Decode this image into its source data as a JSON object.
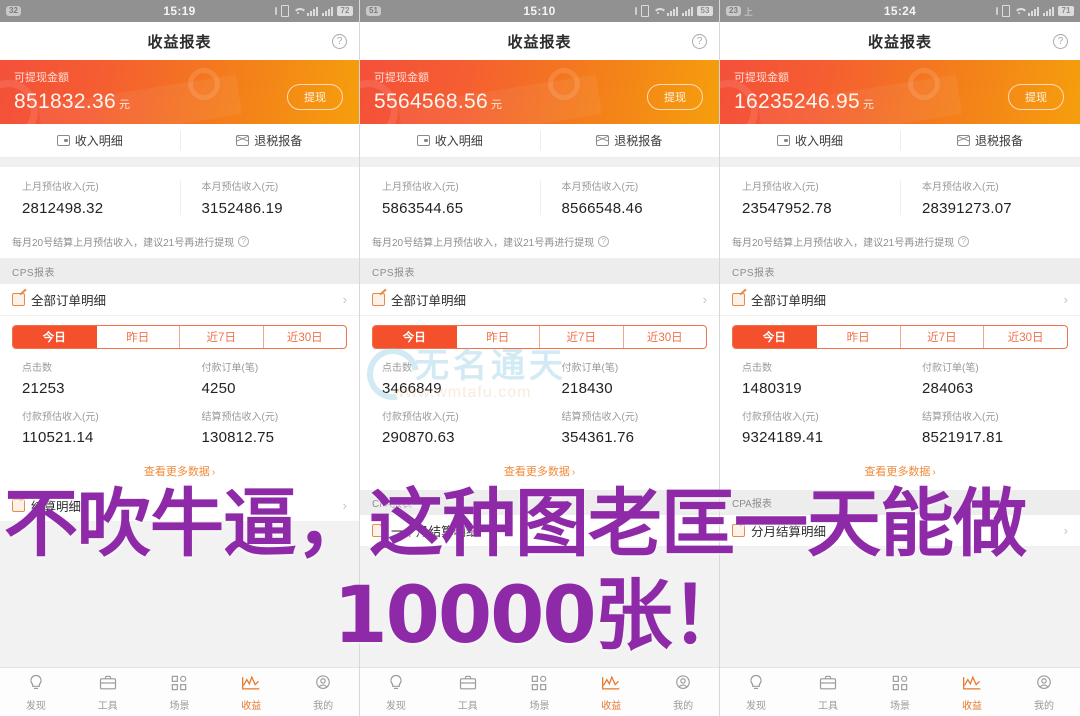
{
  "overlay": {
    "line1": "不吹牛逼，这种图老匡一天能做",
    "line2": "10000张！",
    "color": "#8e2aa8"
  },
  "watermark": {
    "text": "无名通天",
    "url": "www.wmtafu.com"
  },
  "theme": {
    "banner_gradient_start": "#f4503a",
    "banner_gradient_end": "#f59f0c",
    "accent": "#f4502c",
    "tab_active": "#e8762b"
  },
  "common": {
    "nav_title": "收益报表",
    "help_icon": "question-circle-icon",
    "banner_label": "可提现金额",
    "banner_unit": "元",
    "withdraw_label": "提现",
    "entry_income": "收入明细",
    "entry_tax": "退税报备",
    "est_last_label": "上月预估收入(元)",
    "est_this_label": "本月预估收入(元)",
    "notice": "每月20号结算上月预估收入，建议21号再进行提现",
    "cps_section": "CPS报表",
    "all_orders": "全部订单明细",
    "segments": [
      "今日",
      "昨日",
      "近7日",
      "近30日"
    ],
    "active_segment": "今日",
    "stat_clicks_label": "点击数",
    "stat_paid_orders_label": "付款订单(笔)",
    "stat_paid_income_label": "付款预估收入(元)",
    "stat_settle_income_label": "结算预估收入(元)",
    "more_label": "查看更多数据",
    "settle_detail": "结算明细",
    "month_detail": "一个月结算明细",
    "cpa_section": "CPA报表",
    "cpa_detail": "分月结算明细"
  },
  "tabbar": {
    "items": [
      {
        "label": "发现",
        "icon": "lightbulb-icon",
        "active": false
      },
      {
        "label": "工具",
        "icon": "briefcase-icon",
        "active": false
      },
      {
        "label": "场景",
        "icon": "grid-icon",
        "active": false
      },
      {
        "label": "收益",
        "icon": "chart-line-icon",
        "active": true
      },
      {
        "label": "我的",
        "icon": "user-icon",
        "active": false
      }
    ]
  },
  "panels": [
    {
      "status": {
        "time": "15:19",
        "badge": "32",
        "left_text": "",
        "battery": "72"
      },
      "balance": "851832.36",
      "est_last": "2812498.32",
      "est_this": "3152486.19",
      "clicks": "21253",
      "paid_orders": "4250",
      "paid_income": "110521.14",
      "settle_income": "130812.75"
    },
    {
      "status": {
        "time": "15:10",
        "badge": "51",
        "left_text": "",
        "battery": "53"
      },
      "balance": "5564568.56",
      "est_last": "5863544.65",
      "est_this": "8566548.46",
      "clicks": "3466849",
      "paid_orders": "218430",
      "paid_income": "290870.63",
      "settle_income": "354361.76"
    },
    {
      "status": {
        "time": "15:24",
        "badge": "23",
        "left_text": "上",
        "battery": "71"
      },
      "balance": "16235246.95",
      "est_last": "23547952.78",
      "est_this": "28391273.07",
      "clicks": "1480319",
      "paid_orders": "284063",
      "paid_income": "9324189.41",
      "settle_income": "8521917.81"
    }
  ]
}
